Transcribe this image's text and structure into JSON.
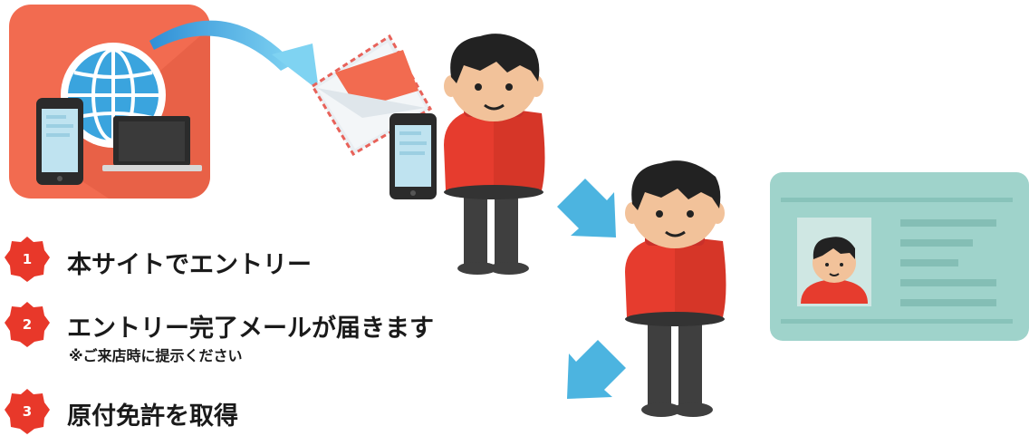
{
  "steps": [
    {
      "number": "1",
      "label": "本サイトでエントリー"
    },
    {
      "number": "2",
      "label": "エントリー完了メールが届きます",
      "note": "※ご来店時に提示ください"
    },
    {
      "number": "3",
      "label": "原付免許を取得"
    }
  ],
  "icons": {
    "web_app": "globe-with-phone-and-laptop-icon",
    "mail": "envelope-mail-icon",
    "phone": "smartphone-icon",
    "license": "license-card-icon",
    "arrows": "down-arrow-icon"
  },
  "colors": {
    "badge_red": "#e8382a",
    "app_tile": "#f26b50",
    "card": "#9fd3cb",
    "arrow_blue": "#4cb4e0",
    "shirt_red": "#e63c2e"
  }
}
